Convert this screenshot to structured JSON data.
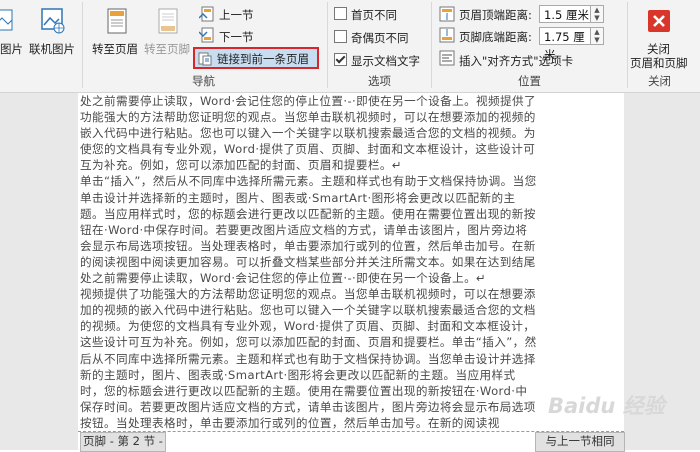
{
  "ribbon": {
    "insert": {
      "picture_label": "图片",
      "online_picture_label": "联机图片"
    },
    "navigation": {
      "group_label": "导航",
      "goto_header_label": "转至页眉",
      "goto_footer_label": "转至页脚",
      "prev_label": "上一节",
      "next_label": "下一节",
      "link_prev_label": "链接到前一条页眉",
      "highlight_color": "#d9262b"
    },
    "options": {
      "group_label": "选项",
      "first_page_diff": {
        "label": "首页不同",
        "checked": false
      },
      "odd_even_diff": {
        "label": "奇偶页不同",
        "checked": false
      },
      "show_doc_text": {
        "label": "显示文档文字",
        "checked": true
      }
    },
    "position": {
      "group_label": "位置",
      "header_top_label": "页眉顶端距离:",
      "header_top_value": "1.5 厘米",
      "footer_bottom_label": "页脚底端距离:",
      "footer_bottom_value": "1.75 厘米",
      "insert_align_tab_label": "插入\"对齐方式\"选项卡"
    },
    "close": {
      "group_label": "关闭",
      "close_line1": "关闭",
      "close_line2": "页眉和页脚",
      "close_color": "#d9362b"
    }
  },
  "document": {
    "paragraphs": [
      "处之前需要停止读取，Word·会记住您的停止位置·-·即使在另一个设备上。视频提供了功能强大的方法帮助您证明您的观点。当您单击联机视频时，可以在想要添加的视频的嵌入代码中进行粘贴。您也可以键入一个关键字以联机搜索最适合您的文档的视频。为使您的文档具有专业外观，Word·提供了页眉、页脚、封面和文本框设计，这些设计可互为补充。例如，您可以添加匹配的封面、页眉和提要栏。↵",
      "单击“插入”，然后从不同库中选择所需元素。主题和样式也有助于文档保持协调。当您单击设计并选择新的主题时，图片、图表或·SmartArt·图形将会更改以匹配新的主题。当应用样式时，您的标题会进行更改以匹配新的主题。使用在需要位置出现的新按钮在·Word·中保存时间。若要更改图片适应文档的方式，请单击该图片，图片旁边将会显示布局选项按钮。当处理表格时，单击要添加行或列的位置，然后单击加号。在新的阅读视图中阅读更加容易。可以折叠文档某些部分并关注所需文本。如果在达到结尾处之前需要停止读取，Word·会记住您的停止位置·-·即使在另一个设备上。↵",
      "视频提供了功能强大的方法帮助您证明您的观点。当您单击联机视频时，可以在想要添加的视频的嵌入代码中进行粘贴。您也可以键入一个关键字以联机搜索最适合您的文档的视频。为使您的文档具有专业外观，Word·提供了页眉、页脚、封面和文本框设计，这些设计可互为补充。例如，您可以添加匹配的封面、页眉和提要栏。单击“插入”，然后从不同库中选择所需元素。主题和样式也有助于文档保持协调。当您单击设计并选择新的主题时，图片、图表或·SmartArt·图形将会更改以匹配新的主题。当应用样式时，您的标题会进行更改以匹配新的主题。使用在需要位置出现的新按钮在·Word·中保存时间。若要更改图片适应文档的方式，请单击该图片，图片旁边将会显示布局选项按钮。当处理表格时，单击要添加行或列的位置，然后单击加号。在新的阅读视"
    ],
    "footer_tab_label": "页脚 - 第 2 节 -",
    "same_as_prev_label": "与上一节相同",
    "watermark": "Baidu 经验"
  }
}
